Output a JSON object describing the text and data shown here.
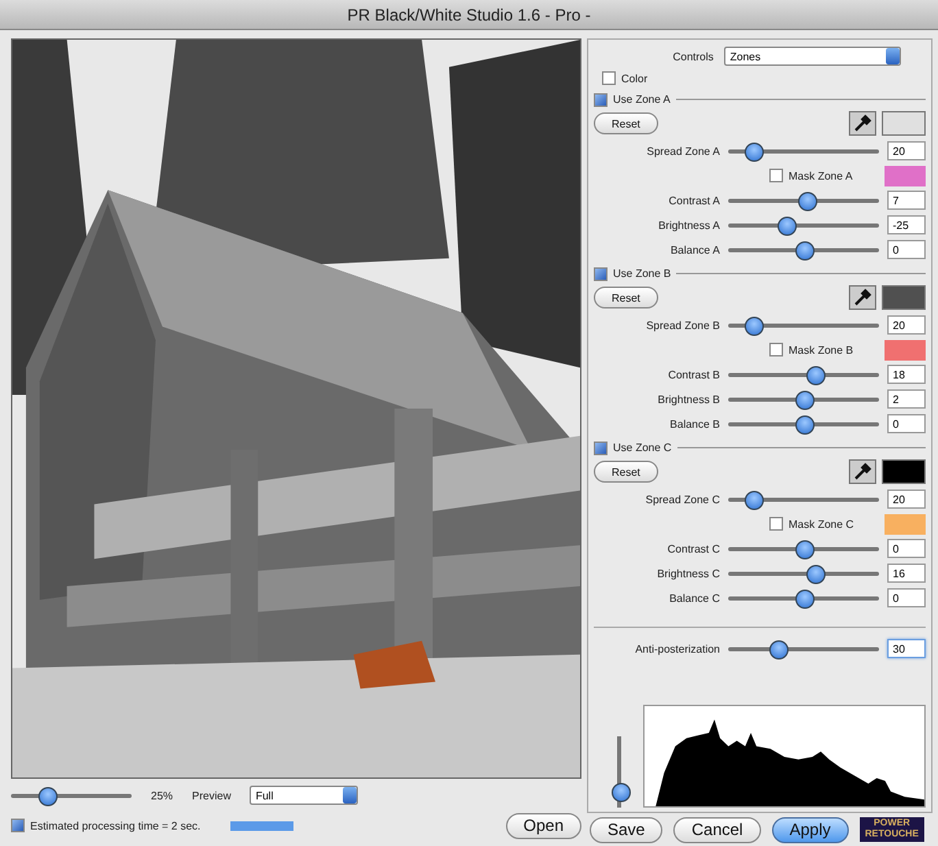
{
  "window": {
    "title": "PR Black/White Studio 1.6 - Pro -"
  },
  "preview_controls": {
    "level": 0.3,
    "zoom_reading": "25%",
    "preview_label": "Preview",
    "preview_value": "Full"
  },
  "estimate": {
    "label": "Estimated processing time = 2 sec.",
    "checked": true,
    "level": 1
  },
  "controls": {
    "label": "Controls",
    "value": "Zones"
  },
  "color_option": {
    "label": "Color",
    "checked": false
  },
  "zones": [
    {
      "label": "Use Zone A",
      "checked": true,
      "reset": "Reset",
      "color": "#e0e0e0",
      "spread": {
        "label": "Spread Zone A",
        "level": 0.16,
        "value": "20"
      },
      "mask": {
        "label": "Mask Zone A",
        "checked": false,
        "color": "#e070c8"
      },
      "sliders": [
        {
          "label": "Contrast A",
          "level": 0.52,
          "value": "7"
        },
        {
          "label": "Brightness A",
          "level": 0.38,
          "value": "-25"
        },
        {
          "label": "Balance A",
          "level": 0.5,
          "value": "0"
        }
      ]
    },
    {
      "label": "Use Zone B",
      "checked": true,
      "reset": "Reset",
      "color": "#505050",
      "spread": {
        "label": "Spread Zone B",
        "level": 0.16,
        "value": "20"
      },
      "mask": {
        "label": "Mask Zone B",
        "checked": false,
        "color": "#f07070"
      },
      "sliders": [
        {
          "label": "Contrast B",
          "level": 0.57,
          "value": "18"
        },
        {
          "label": "Brightness B",
          "level": 0.5,
          "value": "2"
        },
        {
          "label": "Balance B",
          "level": 0.5,
          "value": "0"
        }
      ]
    },
    {
      "label": "Use Zone C",
      "checked": true,
      "reset": "Reset",
      "color": "#000000",
      "spread": {
        "label": "Spread Zone C",
        "level": 0.16,
        "value": "20"
      },
      "mask": {
        "label": "Mask Zone C",
        "checked": false,
        "color": "#f8b060"
      },
      "sliders": [
        {
          "label": "Contrast C",
          "level": 0.5,
          "value": "0"
        },
        {
          "label": "Brightness C",
          "level": 0.57,
          "value": "16"
        },
        {
          "label": "Balance C",
          "level": 0.5,
          "value": "0"
        }
      ]
    }
  ],
  "anti_posterization": {
    "label": "Anti-posterization",
    "level": 0.33,
    "value": "30"
  },
  "histogram_slider": {
    "level": 0.2
  },
  "buttons": [
    {
      "label": "Open",
      "kind": "normal"
    },
    {
      "label": "Save",
      "kind": "normal"
    },
    {
      "label": "Cancel",
      "kind": "normal"
    },
    {
      "label": "Apply",
      "kind": "default"
    }
  ],
  "logo": {
    "line1": "POWER",
    "line2": "RETOUCHE"
  }
}
